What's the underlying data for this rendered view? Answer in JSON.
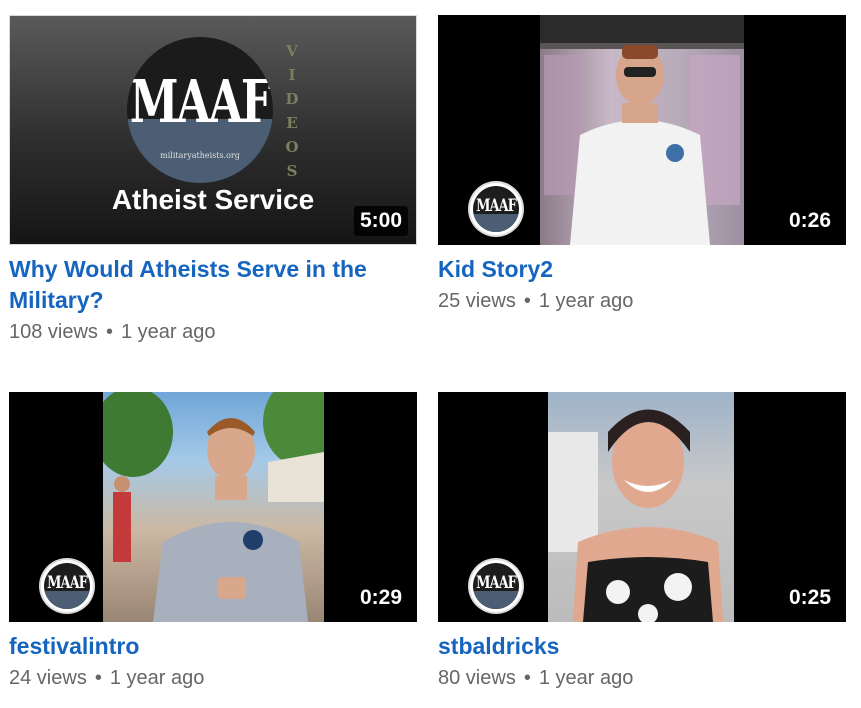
{
  "videos": [
    {
      "title": "Why Would Atheists Serve in the Military?",
      "duration": "5:00",
      "views": "108 views",
      "age": "1 year ago",
      "thumbnail": {
        "logo_text": "MAAF",
        "logo_subtext": "militaryatheists.org",
        "side_text": [
          "V",
          "I",
          "D",
          "E",
          "O",
          "S"
        ],
        "caption": "Atheist Service"
      }
    },
    {
      "title": "Kid Story2",
      "duration": "0:26",
      "views": "25 views",
      "age": "1 year ago",
      "thumbnail": {
        "logo_text": "MAAF"
      }
    },
    {
      "title": "festivalintro",
      "duration": "0:29",
      "views": "24 views",
      "age": "1 year ago",
      "thumbnail": {
        "logo_text": "MAAF"
      }
    },
    {
      "title": "stbaldricks",
      "duration": "0:25",
      "views": "80 views",
      "age": "1 year ago",
      "thumbnail": {
        "logo_text": "MAAF"
      }
    }
  ],
  "separator": "•",
  "colors": {
    "title": "#1565c0",
    "meta": "#666666",
    "duration_bg": "#000000"
  }
}
